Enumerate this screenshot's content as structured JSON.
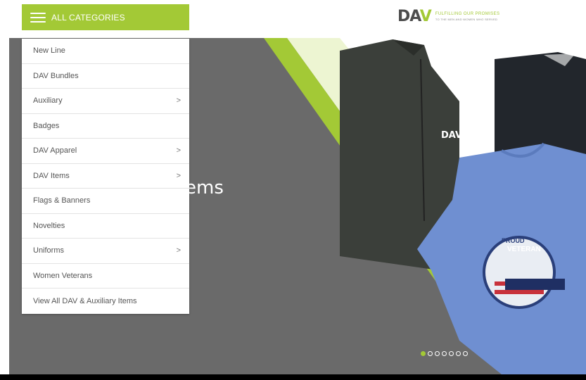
{
  "header": {
    "categories_label": "ALL CATEGORIES",
    "logo": {
      "mark_left": "DA",
      "mark_right": "V",
      "tagline": "FULFILLING OUR PROMISES",
      "subtagline": "TO THE MEN AND WOMEN WHO SERVED"
    }
  },
  "menu": {
    "items": [
      {
        "label": "New Line",
        "has_submenu": false
      },
      {
        "label": "DAV Bundles",
        "has_submenu": false
      },
      {
        "label": "Auxiliary",
        "has_submenu": true
      },
      {
        "label": "Badges",
        "has_submenu": false
      },
      {
        "label": "DAV Apparel",
        "has_submenu": true
      },
      {
        "label": "DAV Items",
        "has_submenu": true
      },
      {
        "label": "Flags & Banners",
        "has_submenu": false
      },
      {
        "label": "Novelties",
        "has_submenu": false
      },
      {
        "label": "Uniforms",
        "has_submenu": true
      },
      {
        "label": "Women Veterans",
        "has_submenu": false
      },
      {
        "label": "View All DAV & Auxiliary Items",
        "has_submenu": false
      }
    ],
    "chevron": ">"
  },
  "hero": {
    "title_fragment": "ems",
    "jacket_logo": "DAV",
    "patch_line1": "PROUD",
    "patch_line2": "VETERAN",
    "slides_total": 7,
    "slide_active": 1
  },
  "colors": {
    "accent": "#a3c936",
    "hero_bg": "#6a6a6a",
    "text": "#555555"
  }
}
